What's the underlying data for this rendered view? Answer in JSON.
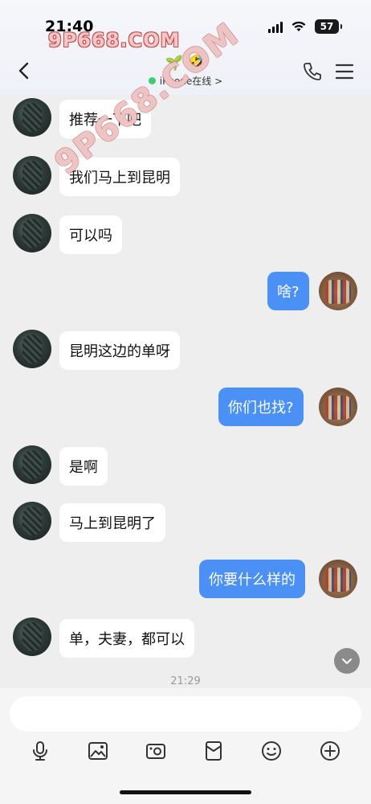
{
  "status_bar": {
    "time": "21:40",
    "battery_level": "57",
    "watermark_text": "9P668.COM"
  },
  "header": {
    "title_emoji": "🌱 🤣",
    "presence_text": "iPhone在线 >",
    "online_color": "#3ccf6b"
  },
  "watermark_center": "9P668.COM",
  "messages": [
    {
      "side": "them",
      "text": "推荐一下吧"
    },
    {
      "side": "them",
      "text": "我们马上到昆明"
    },
    {
      "side": "them",
      "text": "可以吗"
    },
    {
      "side": "me",
      "text": "啥?"
    },
    {
      "side": "them",
      "text": "昆明这边的单呀"
    },
    {
      "side": "me",
      "text": "你们也找?"
    },
    {
      "side": "them",
      "text": "是啊"
    },
    {
      "side": "them",
      "text": "马上到昆明了"
    },
    {
      "side": "me",
      "text": "你要什么样的"
    },
    {
      "side": "them",
      "text": "单，夫妻，都可以"
    }
  ],
  "timestamp": "21:29",
  "composer": {
    "placeholder": ""
  },
  "toolbar": {
    "icons": [
      "microphone-icon",
      "image-icon",
      "camera-icon",
      "gift-icon",
      "emoji-icon",
      "plus-icon"
    ]
  },
  "colors": {
    "my_bubble": "#4a90f5",
    "their_bubble": "#ffffff",
    "background": "#eeeeee"
  }
}
